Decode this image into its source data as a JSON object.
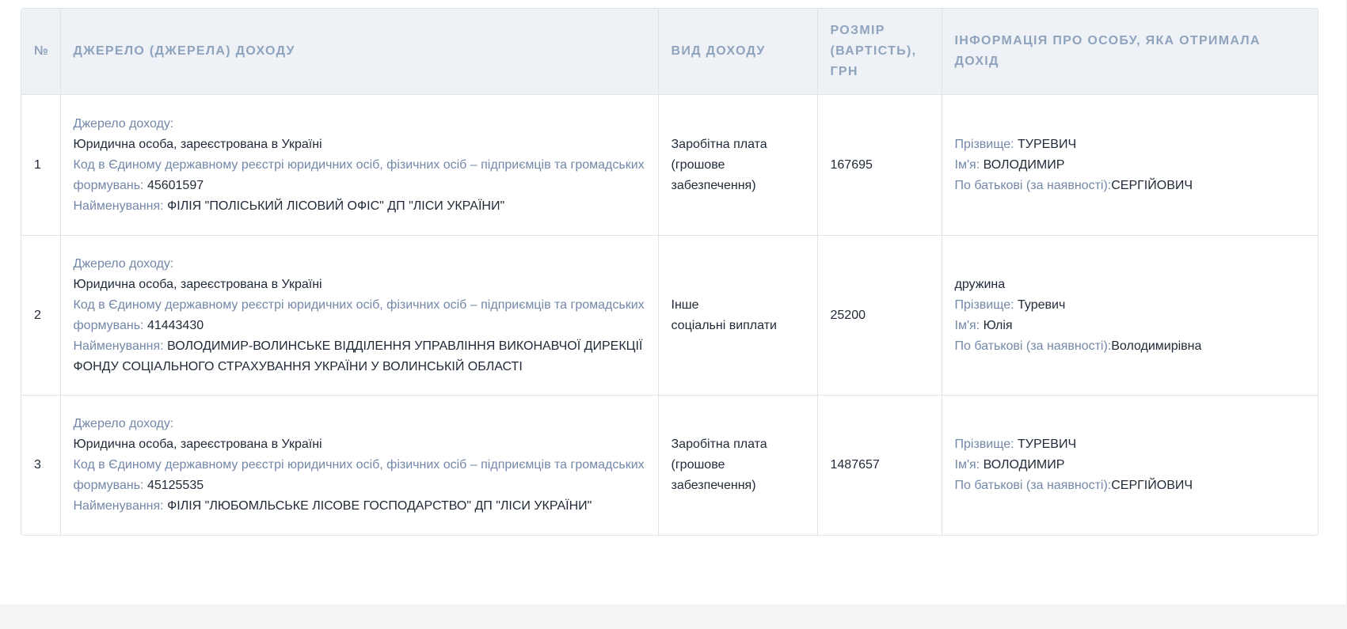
{
  "table": {
    "headers": {
      "no": "№",
      "source": "Джерело (джерела) доходу",
      "type": "Вид доходу",
      "amount": "Розмір (вартість), грн",
      "person": "Інформація про особу, яка отримала дохід"
    },
    "labels": {
      "source_label": "Джерело доходу:",
      "code_label": "Код в Єдиному державному реєстрі юридичних осіб, фізичних осіб – підприємців та громадських формувань:",
      "name_label": "Найменування:",
      "surname_label": "Прізвище:",
      "first_name_label": "Ім'я:",
      "patronymic_label": "По батькові (за наявності):"
    },
    "rows": [
      {
        "no": "1",
        "source_value": "Юридична особа, зареєстрована в Україні",
        "code": "45601597",
        "name": "ФІЛІЯ \"ПОЛІСЬКИЙ ЛІСОВИЙ ОФІС\" ДП \"ЛІСИ УКРАЇНИ\"",
        "type_lines": [
          "Заробітна плата",
          "(грошове",
          "забезпечення)"
        ],
        "amount": "167695",
        "relation": "",
        "surname": "ТУРЕВИЧ",
        "first_name": "ВОЛОДИМИР",
        "patronymic": "СЕРГІЙОВИЧ"
      },
      {
        "no": "2",
        "source_value": "Юридична особа, зареєстрована в Україні",
        "code": "41443430",
        "name": "ВОЛОДИМИР-ВОЛИНСЬКЕ ВІДДІЛЕННЯ УПРАВЛІННЯ ВИКОНАВЧОЇ ДИРЕКЦІЇ ФОНДУ СОЦІАЛЬНОГО СТРАХУВАННЯ УКРАЇНИ У ВОЛИНСЬКІЙ ОБЛАСТІ",
        "type_lines": [
          "Інше",
          "соціальні виплати",
          ""
        ],
        "amount": "25200",
        "relation": "дружина",
        "surname": "Туревич",
        "first_name": "Юлія",
        "patronymic": "Володимирівна"
      },
      {
        "no": "3",
        "source_value": "Юридична особа, зареєстрована в Україні",
        "code": "45125535",
        "name": "ФІЛІЯ \"ЛЮБОМЛЬСЬКЕ ЛІСОВЕ ГОСПОДАРСТВО\" ДП \"ЛІСИ УКРАЇНИ\"",
        "type_lines": [
          "Заробітна плата",
          "(грошове",
          "забезпечення)"
        ],
        "amount": "1487657",
        "relation": "",
        "surname": "ТУРЕВИЧ",
        "first_name": "ВОЛОДИМИР",
        "patronymic": "СЕРГІЙОВИЧ"
      }
    ]
  },
  "colors": {
    "header_bg": "#eef2f7",
    "header_text": "#8fa3bd",
    "label_text": "#7388a8",
    "value_text": "#1f2937",
    "border": "#dfe4ea"
  }
}
